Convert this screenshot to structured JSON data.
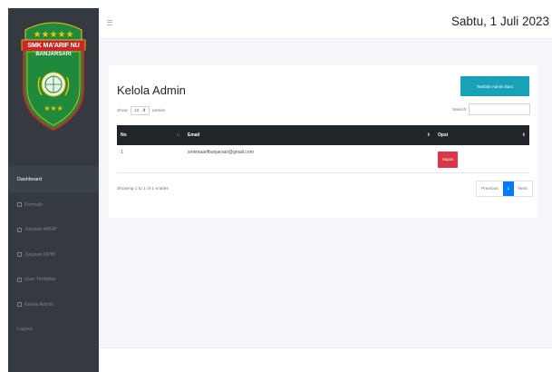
{
  "brand": {
    "school_name_line1": "SMK MA'ARIF NU",
    "school_name_line2": "BANJARSARI",
    "colors": {
      "green": "#1f8a3b",
      "red": "#c62828",
      "gold": "#f4c20d",
      "sidebar_bg": "#343a40"
    }
  },
  "sidebar": {
    "items": [
      {
        "label": "Dashboard",
        "icon": "none",
        "active": true
      },
      {
        "label": "Formulir",
        "icon": "square-icon",
        "active": false
      },
      {
        "label": "Jurusan APHP",
        "icon": "square-icon",
        "active": false
      },
      {
        "label": "Jurusan DPIB",
        "icon": "square-icon",
        "active": false
      },
      {
        "label": "User Terdaftar",
        "icon": "square-icon",
        "active": false
      },
      {
        "label": "Kelola Admin",
        "icon": "square-icon",
        "active": false
      },
      {
        "label": "Logout",
        "icon": "none",
        "active": false
      }
    ]
  },
  "topbar": {
    "menu_icon": "hamburger-icon",
    "date": "Sabtu, 1 Juli 2023"
  },
  "card": {
    "title": "Kelola Admin",
    "add_button": "Tambah Admin Baru",
    "show_label": "Show",
    "entries_value": "10",
    "entries_label": "entries",
    "search_label": "Search:",
    "search_value": ""
  },
  "table": {
    "headers": {
      "no": "No",
      "email": "Email",
      "opsi": "Opsi"
    },
    "rows": [
      {
        "no": "1",
        "email": "smkmaarifbanjarsari@gmail.com",
        "action": "Hapus"
      }
    ],
    "accent_colors": {
      "add": "#17a2b8",
      "delete": "#dc3545",
      "active_page": "#007bff"
    }
  },
  "pagination": {
    "info": "Showing 1 to 1 of 1 entries",
    "previous": "Previous",
    "page": "1",
    "next": "Next"
  }
}
